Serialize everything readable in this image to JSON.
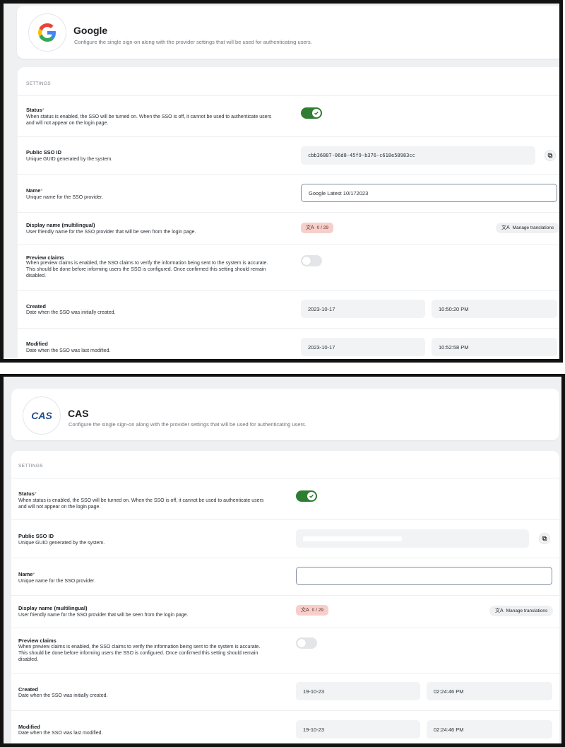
{
  "panels": [
    {
      "provider": {
        "name": "Google",
        "subtitle": "Configure the single sign-on along with the provider settings that will be used for authenticating users.",
        "logo": "google-g-logo"
      },
      "section_title": "SETTINGS",
      "status": {
        "label": "Status",
        "required": "*",
        "description": "When status is enabled, the SSO will be turned on. When the SSO is off, it cannot be used to authenticate users and will not appear on the login page.",
        "enabled": true
      },
      "public_sso_id": {
        "label": "Public SSO ID",
        "description": "Unique GUID generated by the system.",
        "value": "cbb36887-06d8-45f9-b376-c618e58983cc",
        "copy_icon": "copy-icon"
      },
      "name": {
        "label": "Name",
        "required": "*",
        "description": "Unique name for the SSO provider.",
        "value": "Google Latest 10/172023"
      },
      "display_name": {
        "label": "Display name (multilingual)",
        "description": "User friendly name for the SSO provider that will be seen from the login page.",
        "badge": "0 / 29",
        "button": "Manage translations"
      },
      "preview_claims": {
        "label": "Preview claims",
        "description": "When preview claims is enabled, the SSO claims to verify the information being sent to the system is accurate. This should be done before informing users the SSO is configured. Once confirmed this setting should remain disabled.",
        "enabled": false
      },
      "created": {
        "label": "Created",
        "description": "Date when the SSO was initially created.",
        "date": "2023-10-17",
        "time": "10:50:20 PM"
      },
      "modified": {
        "label": "Modified",
        "description": "Date when the SSO was last modified.",
        "date": "2023-10-17",
        "time": "10:52:58 PM"
      }
    },
    {
      "provider": {
        "name": "CAS",
        "subtitle": "Configure the single sign-on along with the provider settings that will be used for authenticating users.",
        "logo": "CAS"
      },
      "section_title": "SETTINGS",
      "status": {
        "label": "Status",
        "required": "*",
        "description": "When status is enabled, the SSO will be turned on. When the SSO is off, it cannot be used to authenticate users and will not appear on the login page.",
        "enabled": true
      },
      "public_sso_id": {
        "label": "Public SSO ID",
        "description": "Unique GUID generated by the system.",
        "value": "",
        "copy_icon": "copy-icon"
      },
      "name": {
        "label": "Name",
        "required": "*",
        "description": "Unique name for the SSO provider.",
        "value": ""
      },
      "display_name": {
        "label": "Display name (multilingual)",
        "description": "User friendly name for the SSO provider that will be seen from the login page.",
        "badge": "0 / 29",
        "button": "Manage translations"
      },
      "preview_claims": {
        "label": "Preview claims",
        "description": "When preview claims is enabled, the SSO claims to verify the information being sent to the system is accurate. This should be done before informing users the SSO is configured. Once confirmed this setting should remain disabled.",
        "enabled": false
      },
      "created": {
        "label": "Created",
        "description": "Date when the SSO was initially created.",
        "date": "19-10-23",
        "time": "02:24:46 PM"
      },
      "modified": {
        "label": "Modified",
        "description": "Date when the SSO was last modified.",
        "date": "19-10-23",
        "time": "02:24:46 PM"
      }
    }
  ],
  "colors": {
    "toggle_on": "#2e7d32",
    "badge_bg": "#f6cfcb",
    "panel_bg": "#eff0f2",
    "border": "#121212"
  }
}
